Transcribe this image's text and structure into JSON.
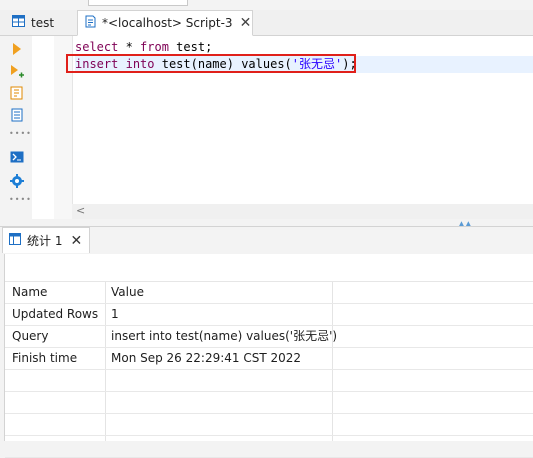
{
  "tabs": {
    "inactive": {
      "label": "test"
    },
    "active": {
      "label": "*<localhost> Script-3",
      "close": "✕"
    }
  },
  "editor": {
    "line1": {
      "kw1": "select",
      "mid": " * ",
      "kw2": "from",
      "rest": " test;"
    },
    "line2": {
      "kw1": "insert",
      "sp1": " ",
      "kw2": "into",
      "mid": " test(name) values(",
      "str": "'张无忌'",
      "end": ");"
    }
  },
  "results": {
    "tab_label": "统计 1",
    "tab_close": "✕",
    "header": {
      "name": "Name",
      "value": "Value"
    },
    "rows": [
      {
        "name": "Updated Rows",
        "value": "1"
      },
      {
        "name": "Query",
        "value": "insert into test(name) values('张无忌')"
      },
      {
        "name": "Finish time",
        "value": "Mon Sep 26 22:29:41 CST 2022"
      }
    ]
  },
  "colors": {
    "keyword": "#7f0055",
    "string": "#2a00ff",
    "highlight_box": "#e0201a",
    "accent": "#1e7fd6"
  },
  "icons": [
    "table-icon",
    "script-icon",
    "run-statement-icon",
    "run-script-icon",
    "explain-plan-icon",
    "export-icon",
    "console-icon",
    "settings-icon",
    "results-grid-icon"
  ]
}
